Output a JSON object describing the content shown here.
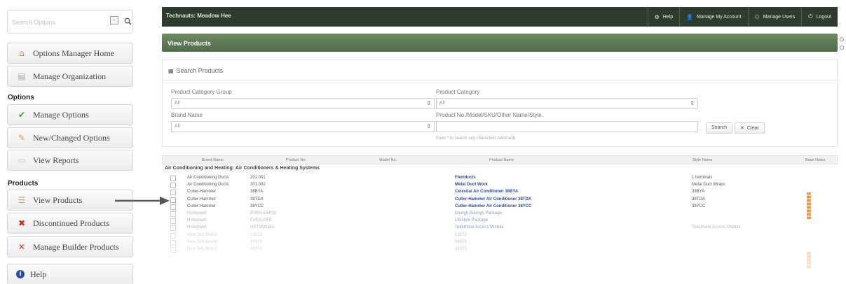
{
  "sidebar": {
    "search_placeholder": "Search Options",
    "items_top": [
      {
        "label": "Options Manager Home",
        "icon": "home-icon"
      },
      {
        "label": "Manage Organization",
        "icon": "building-icon"
      }
    ],
    "section_options": "Options",
    "items_options": [
      {
        "label": "Manage Options",
        "icon": "checkmark-icon"
      },
      {
        "label": "New/Changed Options",
        "icon": "pencil-icon"
      },
      {
        "label": "View Reports",
        "icon": "document-icon"
      }
    ],
    "section_products": "Products",
    "items_products": [
      {
        "label": "View Products",
        "icon": "list-icon"
      },
      {
        "label": "Discontinued Products",
        "icon": "red-x-icon"
      },
      {
        "label": "Manage Builder Products",
        "icon": "tools-icon"
      }
    ],
    "help_label": "Help"
  },
  "topbar": {
    "welcome": "Technauts: Meadow Hee",
    "links": [
      {
        "label": "Help",
        "icon": "settings-icon"
      },
      {
        "label": "Manage My Account",
        "icon": "user-icon"
      },
      {
        "label": "Manage Users",
        "icon": "users-icon"
      },
      {
        "label": "Logout",
        "icon": "power-icon"
      }
    ]
  },
  "panel_title": "View Products",
  "search": {
    "header": "Search Products",
    "product_category_group_label": "Product Category Group",
    "product_category_group_value": "All",
    "product_category_label": "Product Category",
    "product_category_value": "All",
    "brand_name_label": "Brand Name",
    "brand_name_value": "All",
    "product_no_label": "Product No./Model/SKU/Other Name/Style",
    "product_no_hint": "Enter * to search any characters (wildcard)",
    "search_button": "Search",
    "clear_button": "Clear"
  },
  "table": {
    "columns": [
      "Brand Name",
      "Product No.",
      "Model No.",
      "Product Name",
      "Style Name",
      "Base Notes"
    ],
    "group": "Air Conditioning and Heating: Air Conditioners & Heating Systems",
    "rows": [
      {
        "brand": "Air Conditioning Ducts",
        "product_no": "201.001",
        "name": "Flexiducts",
        "style": "1 terminals",
        "fade": ""
      },
      {
        "brand": "Air Conditioning Ducts",
        "product_no": "201.002",
        "name": "Metal Duct Work",
        "style": "Metal Duct Wraps",
        "fade": ""
      },
      {
        "brand": "Cutler-Hammer",
        "product_no": "38BYA",
        "name": "Celestial Air Conditioner 38BYA",
        "style": "38BYA",
        "fade": ""
      },
      {
        "brand": "Cutler-Hammer",
        "product_no": "38TDA",
        "name": "Cutler-Hammer Air Conditioner 38TDA",
        "style": "38TDA",
        "fade": ""
      },
      {
        "brand": "Cutler-Hammer",
        "product_no": "38YCC",
        "name": "Cutler-Hammer Air Conditioner 38YCC",
        "style": "38YCC",
        "fade": ""
      },
      {
        "brand": "Honeywell",
        "product_no": "EVEN-ESP32",
        "name": "Energy Savings Package",
        "style": "",
        "fade": "faded"
      },
      {
        "brand": "Honeywell",
        "product_no": "EVEN-LIFE",
        "name": "Lifestyle Package",
        "style": "",
        "fade": "faded"
      },
      {
        "brand": "Honeywell",
        "product_no": "HSTSM1151",
        "name": "Telephone Access Module",
        "style": "Telephone Access Module",
        "fade": "faded"
      },
      {
        "brand": "New Test Brand",
        "product_no": "13273",
        "name": "13273",
        "style": "",
        "fade": "faded2"
      },
      {
        "brand": "New Test Brand",
        "product_no": "34373",
        "name": "34373",
        "style": "",
        "fade": "faded2"
      },
      {
        "brand": "New Test Brand",
        "product_no": "44373",
        "name": "44373",
        "style": "",
        "fade": "faded2"
      }
    ]
  },
  "colors": {
    "topbar": "#2f3b2e",
    "panel_title": "#5a7752",
    "link_blue": "#2c4a9a",
    "accent_orange": "#e89a4a"
  }
}
